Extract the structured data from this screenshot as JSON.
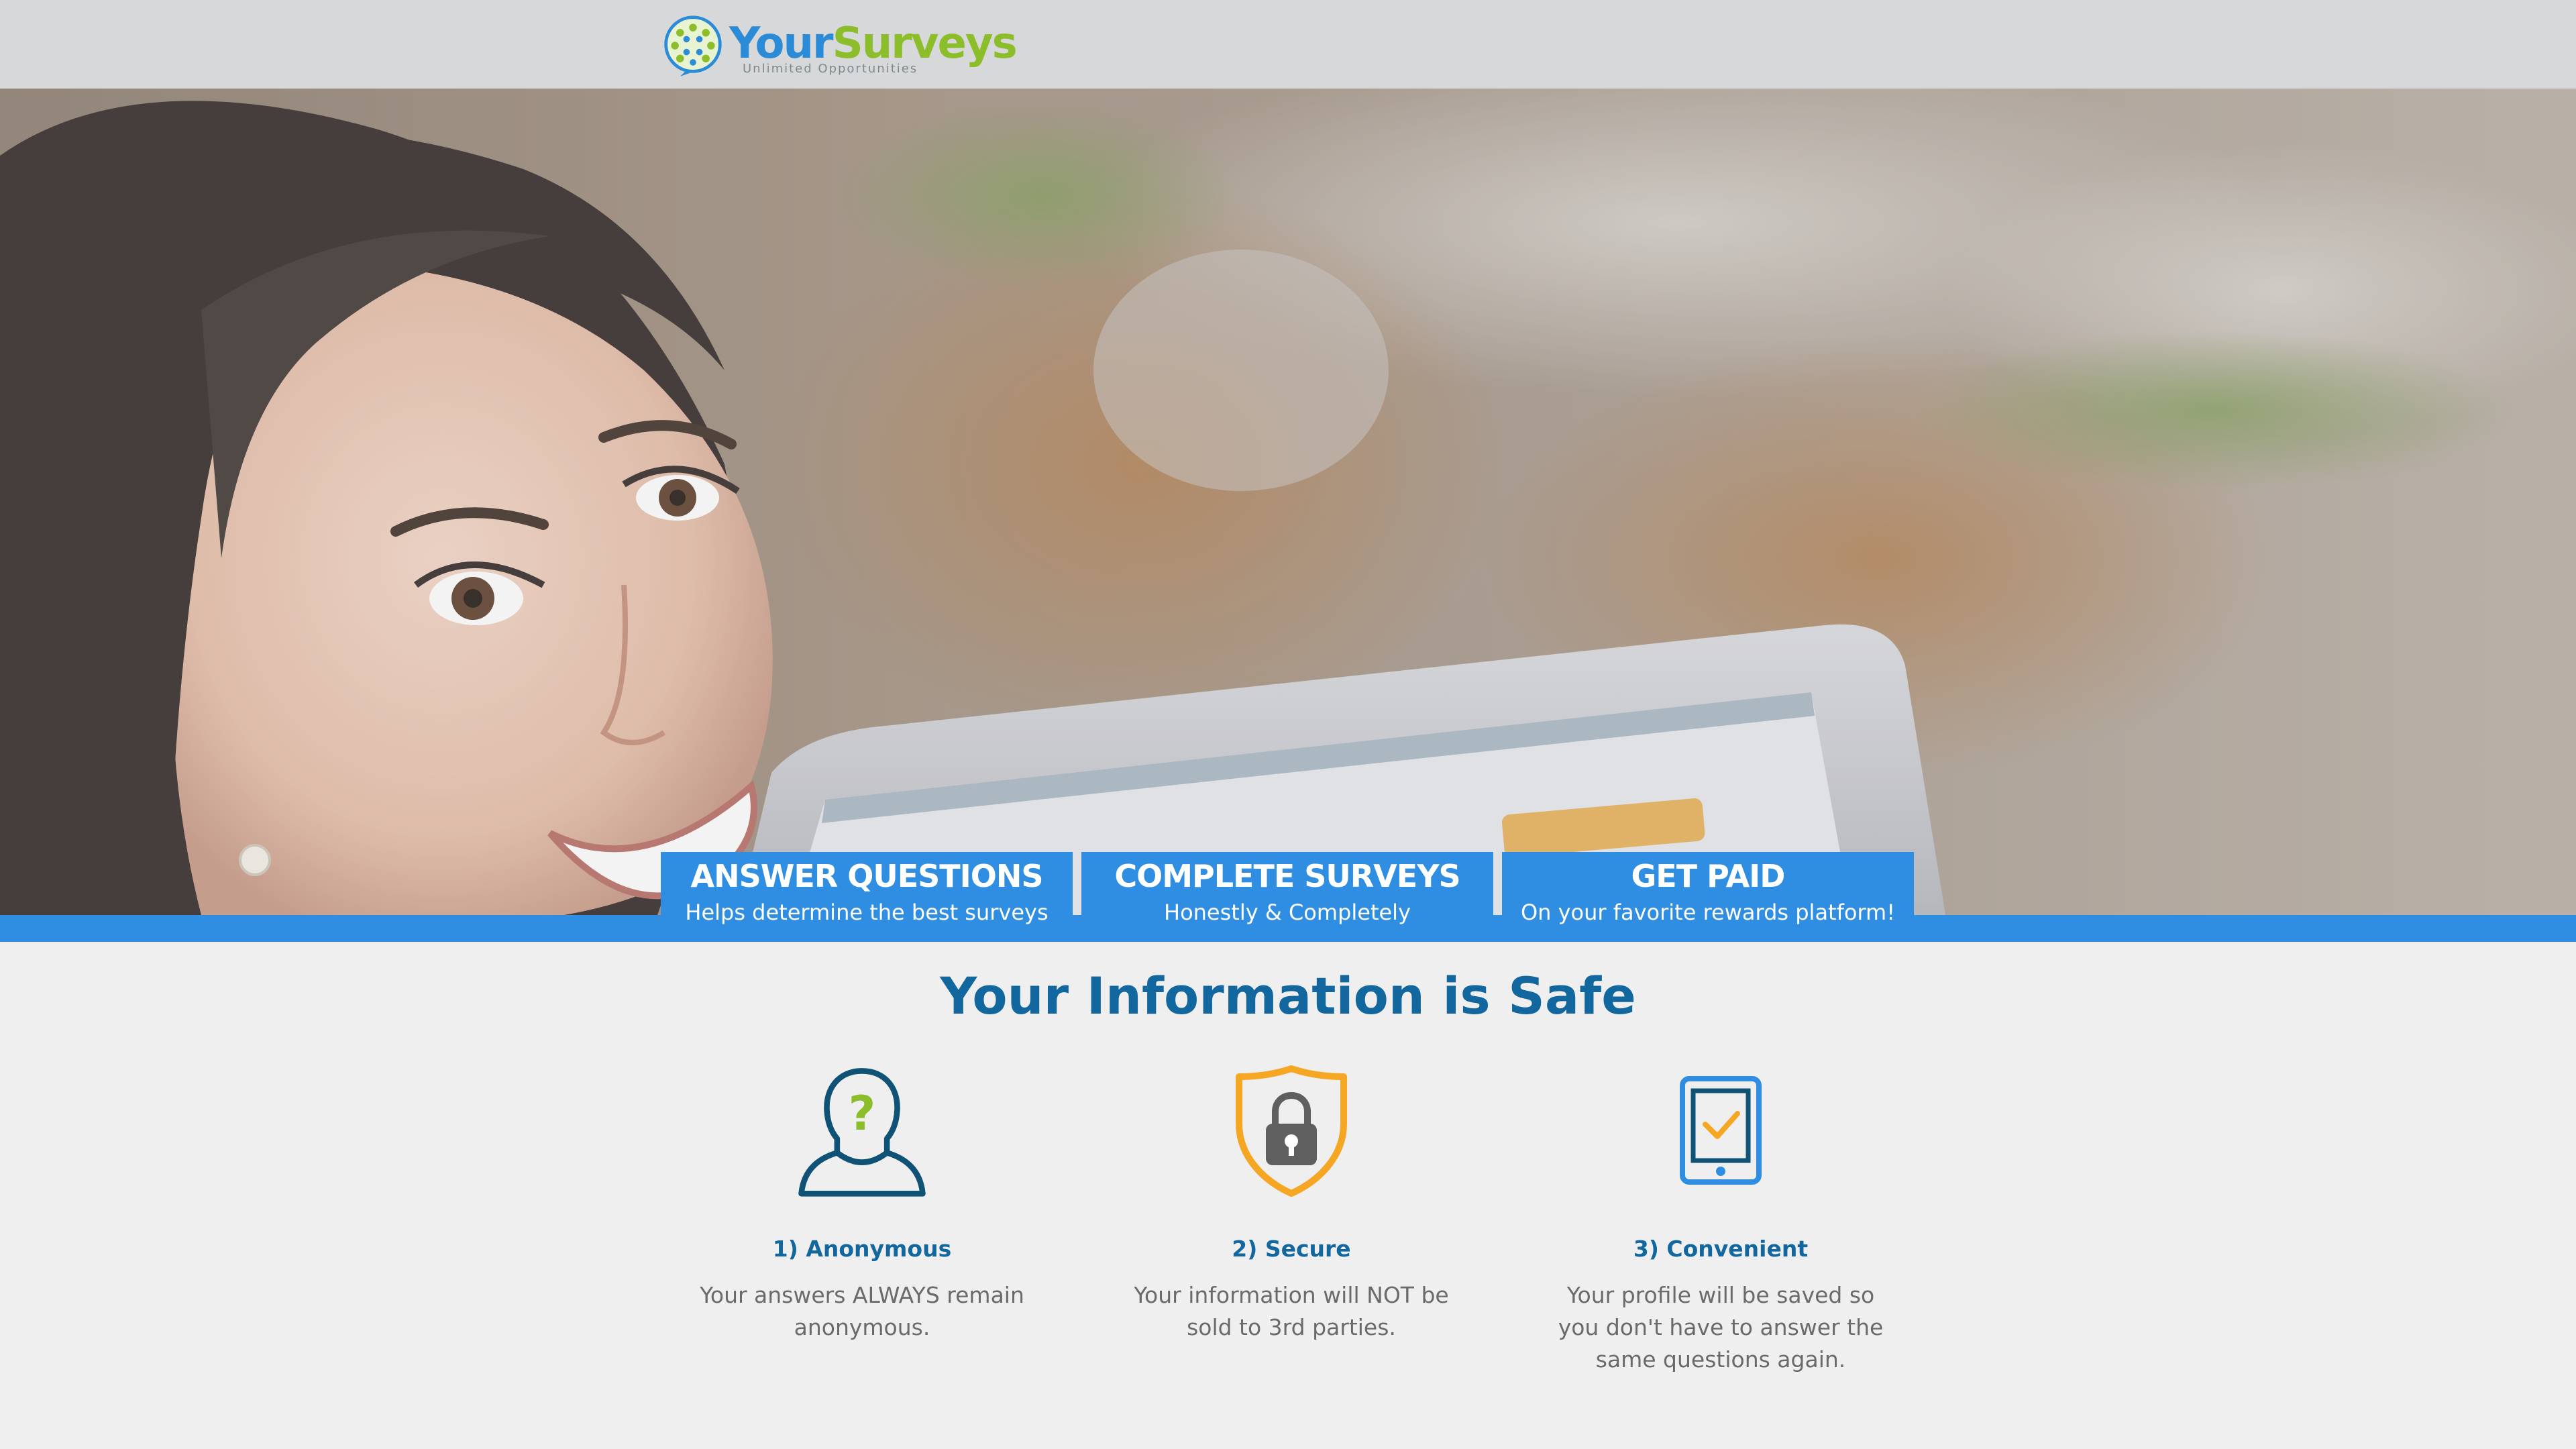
{
  "header": {
    "logo_word_1": "Your",
    "logo_word_2": "Surveys",
    "logo_tagline": "Unlimited Opportunities"
  },
  "steps": [
    {
      "title": "ANSWER QUESTIONS",
      "subtitle": "Helps determine the best surveys"
    },
    {
      "title": "COMPLETE SURVEYS",
      "subtitle": "Honestly & Completely"
    },
    {
      "title": "GET PAID",
      "subtitle": "On your favorite rewards platform!"
    }
  ],
  "safe_section": {
    "heading": "Your Information is Safe",
    "features": [
      {
        "icon": "anonymous-person-icon",
        "title": "1) Anonymous",
        "text": "Your answers ALWAYS remain anonymous."
      },
      {
        "icon": "secure-shield-lock-icon",
        "title": "2) Secure",
        "text": "Your information will NOT be sold to 3rd parties."
      },
      {
        "icon": "tablet-check-icon",
        "title": "3) Convenient",
        "text": "Your profile will be saved so you don't have to answer the same questions again."
      }
    ]
  },
  "colors": {
    "brand_blue": "#2f8ee2",
    "heading_blue": "#12679e",
    "brand_green": "#8cbd2a",
    "accent_orange": "#f5a623"
  }
}
